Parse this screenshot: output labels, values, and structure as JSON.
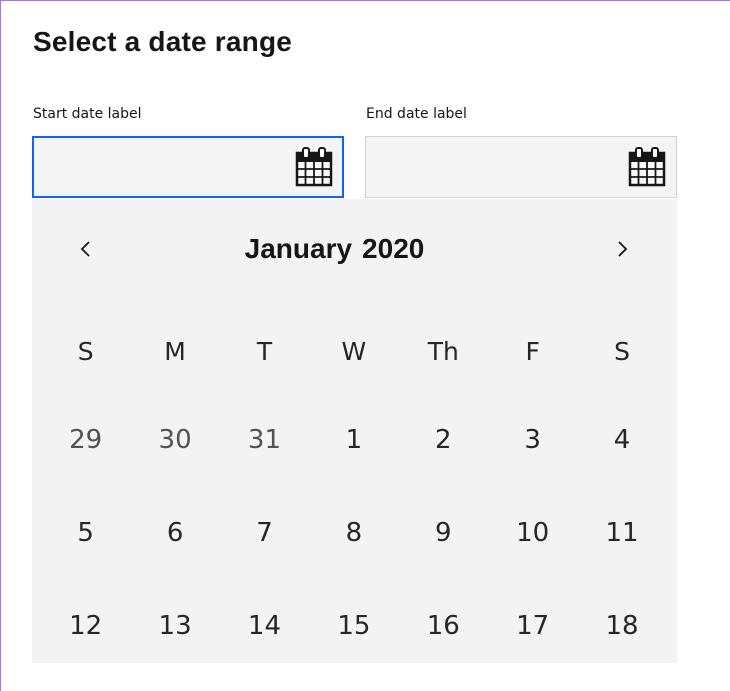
{
  "page": {
    "title": "Select a date range"
  },
  "start_field": {
    "label": "Start date label",
    "value": "",
    "placeholder": "",
    "icon": "calendar-icon"
  },
  "end_field": {
    "label": "End date label",
    "value": "",
    "placeholder": "",
    "icon": "calendar-icon"
  },
  "calendar": {
    "month": "January",
    "year": "2020",
    "prev_icon": "chevron-left-icon",
    "next_icon": "chevron-right-icon",
    "weekdays": [
      "S",
      "M",
      "T",
      "W",
      "Th",
      "F",
      "S"
    ],
    "weeks": [
      [
        "29",
        "30",
        "31",
        "1",
        "2",
        "3",
        "4"
      ],
      [
        "5",
        "6",
        "7",
        "8",
        "9",
        "10",
        "11"
      ],
      [
        "12",
        "13",
        "14",
        "15",
        "16",
        "17",
        "18"
      ]
    ]
  },
  "colors": {
    "focus_border": "#0f62fe",
    "panel_bg": "#f3f3f3",
    "field_bg": "#f4f4f4",
    "frame_border": "#a56eff"
  }
}
